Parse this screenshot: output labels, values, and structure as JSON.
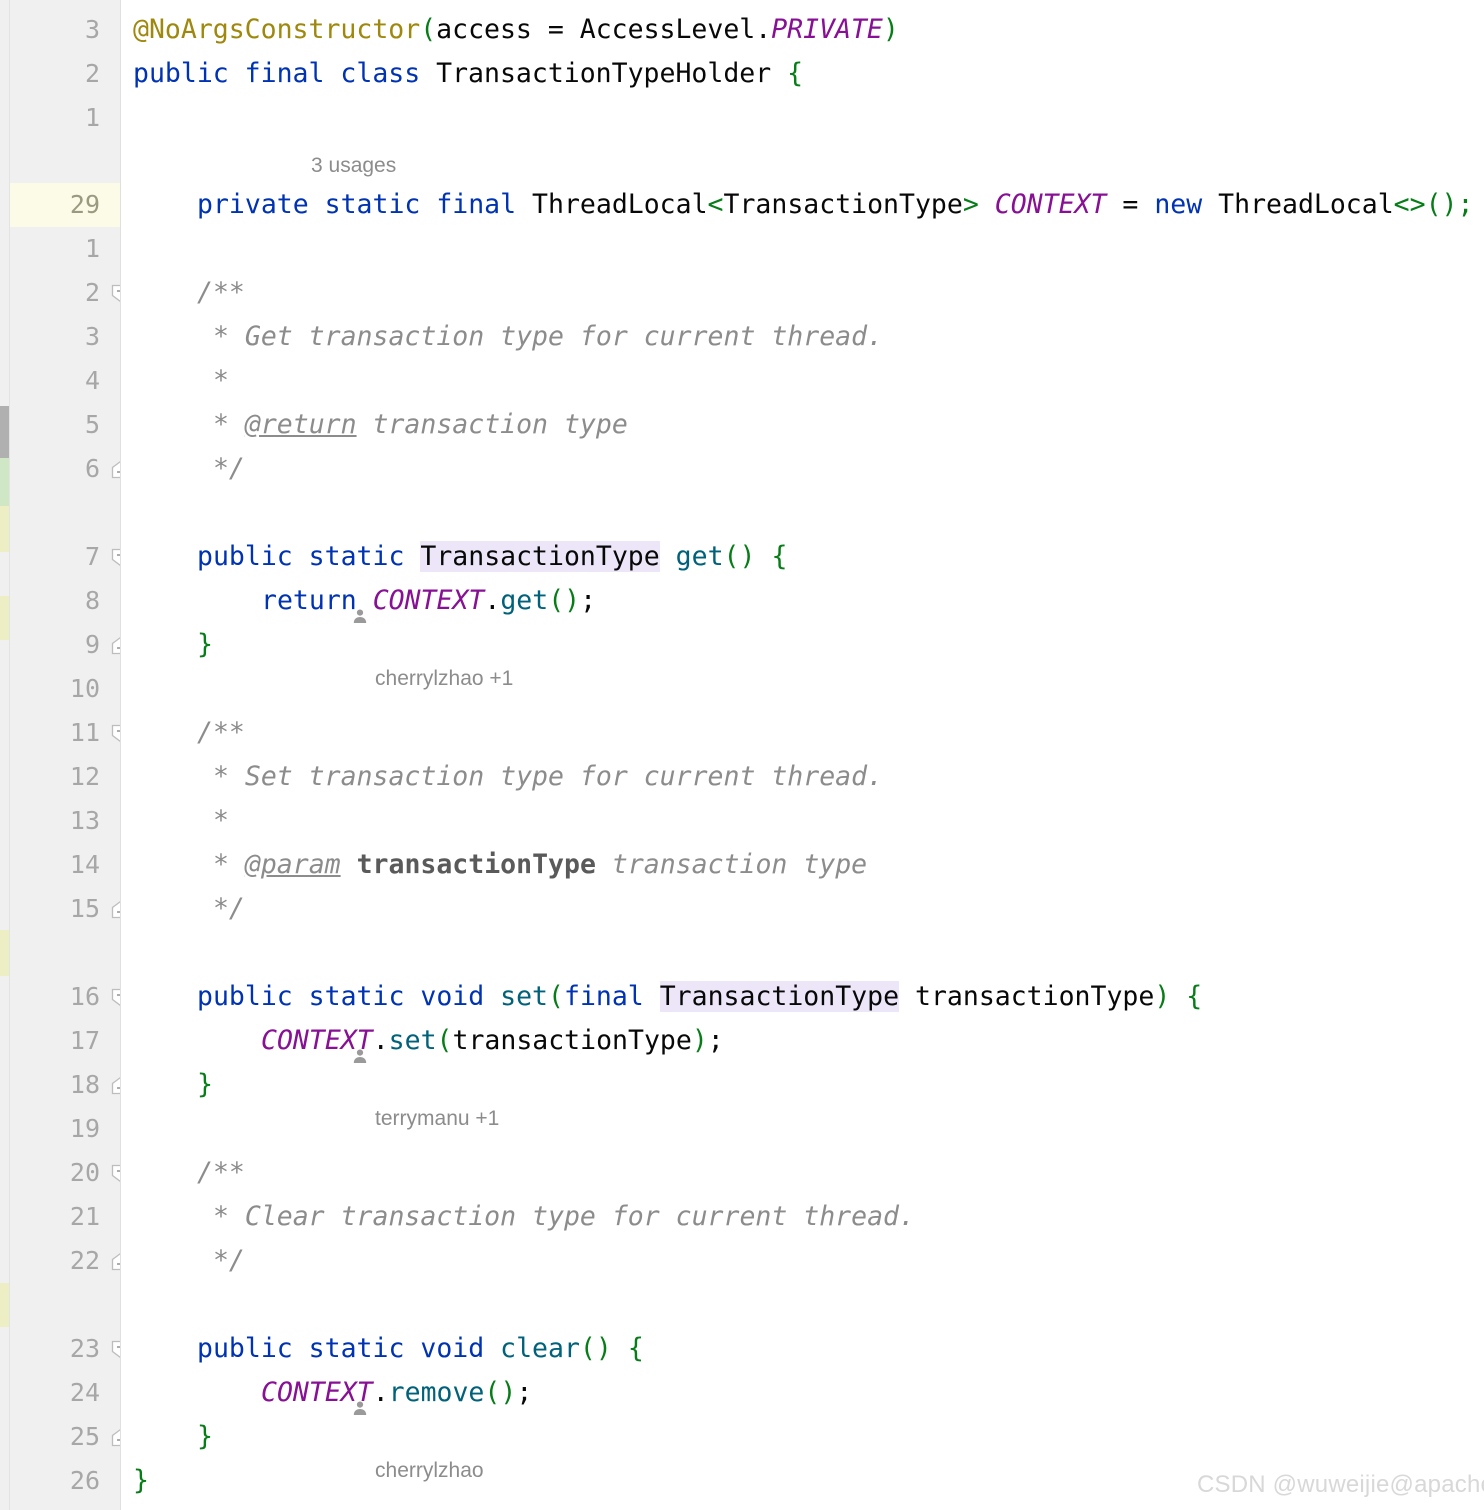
{
  "editor": {
    "app": "intellij-idea-editor",
    "colors": {
      "gutter_bg": "#f0f0f0",
      "editor_bg": "#ffffff",
      "selection": "#a6d2ff",
      "current_line_gutter": "#fbfbe8",
      "keyword": "#0033b3",
      "annotation": "#9e880d",
      "bracket": "#067d17",
      "static_field": "#871094",
      "method": "#00627a",
      "comment": "#8c8c8c",
      "identifier_highlight": "#ece6f8",
      "line_number": "#a7a7a7",
      "watermark": "#d8d8d8"
    },
    "gutter_line_numbers": [
      "3",
      "2",
      "1",
      "29",
      "1",
      "2",
      "3",
      "4",
      "5",
      "6",
      "7",
      "8",
      "9",
      "10",
      "11",
      "12",
      "13",
      "14",
      "15",
      "16",
      "17",
      "18",
      "19",
      "20",
      "21",
      "22",
      "23",
      "24",
      "25",
      "26"
    ],
    "current_line_number": "29",
    "inline_hints": [
      {
        "id": "usages",
        "icon": null,
        "text": "3 usages"
      },
      {
        "id": "author-get",
        "icon": "person-icon",
        "text": "cherrylzhao +1"
      },
      {
        "id": "author-set",
        "icon": "person-icon",
        "text": "terrymanu +1"
      },
      {
        "id": "author-clear",
        "icon": "person-icon",
        "text": "cherrylzhao"
      }
    ],
    "fold_markers": [
      {
        "id": "fold-open-javadoc-get",
        "state": "expanded-start"
      },
      {
        "id": "fold-close-javadoc-get",
        "state": "expanded-end"
      },
      {
        "id": "fold-open-method-get",
        "state": "expanded-start"
      },
      {
        "id": "fold-close-method-get",
        "state": "expanded-end"
      },
      {
        "id": "fold-open-javadoc-set",
        "state": "expanded-start"
      },
      {
        "id": "fold-close-javadoc-set",
        "state": "expanded-end"
      },
      {
        "id": "fold-open-method-set",
        "state": "expanded-start"
      },
      {
        "id": "fold-close-method-set",
        "state": "expanded-end"
      },
      {
        "id": "fold-open-javadoc-clear",
        "state": "expanded-start"
      },
      {
        "id": "fold-close-javadoc-clear",
        "state": "expanded-end"
      },
      {
        "id": "fold-open-method-clear",
        "state": "expanded-start"
      },
      {
        "id": "fold-close-method-clear",
        "state": "expanded-end"
      }
    ],
    "code_lines": [
      "@NoArgsConstructor(access = AccessLevel.PRIVATE)",
      "public final class TransactionTypeHolder {",
      "",
      "    private static final ThreadLocal<TransactionType> CONTEXT = new ThreadLocal<>();",
      "",
      "    /**",
      "     * Get transaction type for current thread.",
      "     *",
      "     * @return transaction type",
      "     */",
      "    public static TransactionType get() {",
      "        return CONTEXT.get();",
      "    }",
      "",
      "    /**",
      "     * Set transaction type for current thread.",
      "     *",
      "     * @param transactionType transaction type",
      "     */",
      "    public static void set(final TransactionType transactionType) {",
      "        CONTEXT.set(transactionType);",
      "    }",
      "",
      "    /**",
      "     * Clear transaction type for current thread.",
      "     */",
      "    public static void clear() {",
      "        CONTEXT.remove();",
      "    }",
      "}"
    ]
  },
  "watermark": {
    "text": "CSDN @wuweijie@apache.org"
  }
}
